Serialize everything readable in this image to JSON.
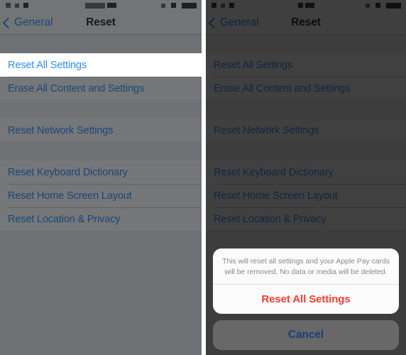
{
  "colors": {
    "tint_blue": "#0a7cff",
    "destructive_red": "#ff3b30",
    "list_background": "#efeff4",
    "row_background": "#ffffff",
    "separator": "#c8c7cc",
    "dim_light": "rgba(38,40,42,0.63)",
    "dim_heavy": "rgba(16,16,16,0.80)"
  },
  "panels": {
    "left": {
      "navbar": {
        "back_label": "General",
        "title": "Reset",
        "back_icon": "chevron-left-icon"
      },
      "rows": [
        {
          "label": "Reset All Settings",
          "selected": true
        },
        {
          "label": "Erase All Content and Settings",
          "selected": false
        },
        {
          "label": "Reset Network Settings",
          "selected": false
        },
        {
          "label": "Reset Keyboard Dictionary",
          "selected": false
        },
        {
          "label": "Reset Home Screen Layout",
          "selected": false
        },
        {
          "label": "Reset Location & Privacy",
          "selected": false
        }
      ]
    },
    "right": {
      "navbar": {
        "back_label": "General",
        "title": "Reset",
        "back_icon": "chevron-left-icon"
      },
      "rows": [
        {
          "label": "Reset All Settings",
          "selected": false
        },
        {
          "label": "Erase All Content and Settings",
          "selected": false
        },
        {
          "label": "Reset Network Settings",
          "selected": false
        },
        {
          "label": "Reset Keyboard Dictionary",
          "selected": false
        },
        {
          "label": "Reset Home Screen Layout",
          "selected": false
        },
        {
          "label": "Reset Location & Privacy",
          "selected": false
        }
      ],
      "alert": {
        "message": "This will reset all settings and your Apple Pay cards will be removed. No data or media will be deleted.",
        "confirm_label": "Reset All Settings",
        "cancel_label": "Cancel"
      }
    }
  },
  "statusbar": {
    "signal_icon": "signal-bars-icon",
    "carrier_icon": "carrier-label-icon",
    "wifi_icon": "wifi-icon",
    "time_icon": "clock-time-icon",
    "bluetooth_icon": "bluetooth-icon",
    "battery_icon": "battery-icon"
  }
}
